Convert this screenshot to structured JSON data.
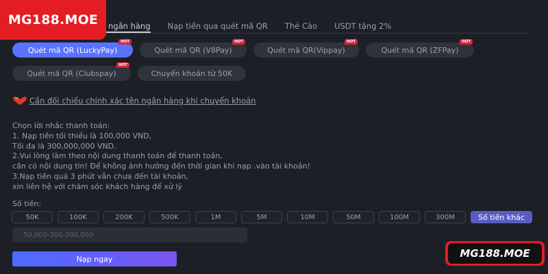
{
  "brand": {
    "logo_text": "MG188.MOE",
    "bottom_badge_text": "MG188.MOE"
  },
  "tabs": [
    {
      "label": "ngân hàng",
      "active": true
    },
    {
      "label": "Nạp tiền qua quét mã QR",
      "active": false
    },
    {
      "label": "Thẻ Cào",
      "active": false
    },
    {
      "label": "USDT tặng 2%",
      "active": false
    }
  ],
  "methods": [
    {
      "label": "Quét mã QR (LuckyPay)",
      "hot": "HOT",
      "active": true
    },
    {
      "label": "Quét mã QR  (V8Pay)",
      "hot": "HOT",
      "active": false
    },
    {
      "label": "Quét mã QR(Vippay)",
      "hot": "HOT",
      "active": false
    },
    {
      "label": "Quét mã QR  (ZFPay)",
      "hot": "HOT",
      "active": false
    },
    {
      "label": "Quét mã QR (Clubspay)",
      "hot": "HOT",
      "active": false
    },
    {
      "label": "Chuyển khoản từ 50K",
      "hot": "",
      "active": false
    }
  ],
  "notice": {
    "text": "Cần đối chiếu chính xác tên ngân hàng khi chuyển khoản"
  },
  "instructions": [
    "Chọn lời nhắc thanh toán:",
    "1. Nạp tiền tối thiểu là 100,000 VND,",
    "Tối đa là 300,000,000 VND.",
    "2.Vui lòng làm theo nội dung thanh toán để thanh toán,",
    "cần có nội dung tin! Để không ảnh hưởng đến thời gian khi nạp .vào tài khoản!",
    "3.Nạp tiền quá 3 phút vẫn chưa đến tài khoản,",
    "xin liên hệ với chăm sóc khách hàng để xử lý"
  ],
  "amount": {
    "label": "Số tiền:",
    "options": [
      "50K",
      "100K",
      "200K",
      "500K",
      "1M",
      "5M",
      "10M",
      "50M",
      "100M",
      "300M"
    ],
    "other_label": "Số tiền khác",
    "placeholder": "50,000-300,000,000"
  },
  "submit_label": "Nạp ngay",
  "colors": {
    "accent": "#5a73ff",
    "brand_red": "#e41c24",
    "background": "#1c1f26"
  }
}
